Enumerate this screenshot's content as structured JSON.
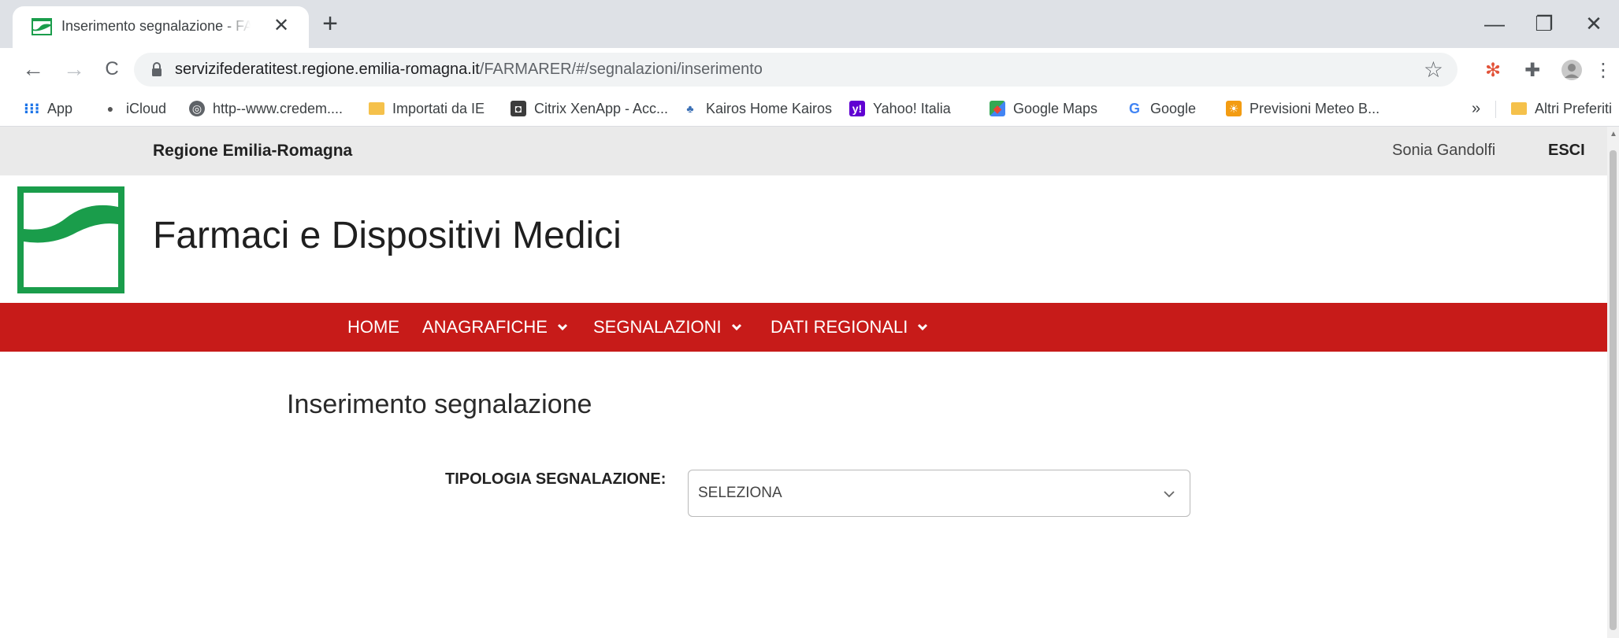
{
  "browser": {
    "tab_title": "Inserimento segnalazione - FARMARER",
    "tab_close": "✕",
    "new_tab": "+",
    "url_host": "servizifederatitest.regione.emilia-romagna.it",
    "url_path": "/FARMARER/#/segnalazioni/inserimento",
    "window_controls": {
      "minimize": "—",
      "maximize": "❐",
      "close": "✕"
    },
    "nav": {
      "back": "←",
      "forward": "→",
      "reload": "C"
    },
    "bookmarks": [
      {
        "label": "App",
        "icon": "apps-grid-icon"
      },
      {
        "label": "iCloud",
        "icon": "apple-icon"
      },
      {
        "label": "http--www.credem....",
        "icon": "globe-icon"
      },
      {
        "label": "Importati da IE",
        "icon": "folder-icon"
      },
      {
        "label": "Citrix XenApp - Acc...",
        "icon": "citrix-icon"
      },
      {
        "label": "Kairos Home Kairos",
        "icon": "kairos-icon"
      },
      {
        "label": "Yahoo! Italia",
        "icon": "yahoo-icon"
      },
      {
        "label": "Google Maps",
        "icon": "maps-icon"
      },
      {
        "label": "Google",
        "icon": "google-icon"
      },
      {
        "label": "Previsioni Meteo B...",
        "icon": "weather-icon"
      }
    ],
    "bookmarks_overflow": "»",
    "other_bookmarks": "Altri Preferiti"
  },
  "page": {
    "region_name": "Regione Emilia-Romagna",
    "user_name": "Sonia Gandolfi",
    "logout": "ESCI",
    "site_title": "Farmaci e Dispositivi Medici",
    "nav_items": [
      {
        "label": "HOME",
        "dropdown": false
      },
      {
        "label": "ANAGRAFICHE",
        "dropdown": true
      },
      {
        "label": "SEGNALAZIONI",
        "dropdown": true
      },
      {
        "label": "DATI REGIONALI",
        "dropdown": true
      }
    ],
    "heading": "Inserimento segnalazione",
    "form": {
      "tipologia_label": "TIPOLOGIA SEGNALAZIONE:",
      "tipologia_value": "SELEZIONA"
    }
  },
  "colors": {
    "navbar_red": "#c71b19",
    "logo_green": "#1a9d4b",
    "topbar_gray": "#eaeaea"
  }
}
